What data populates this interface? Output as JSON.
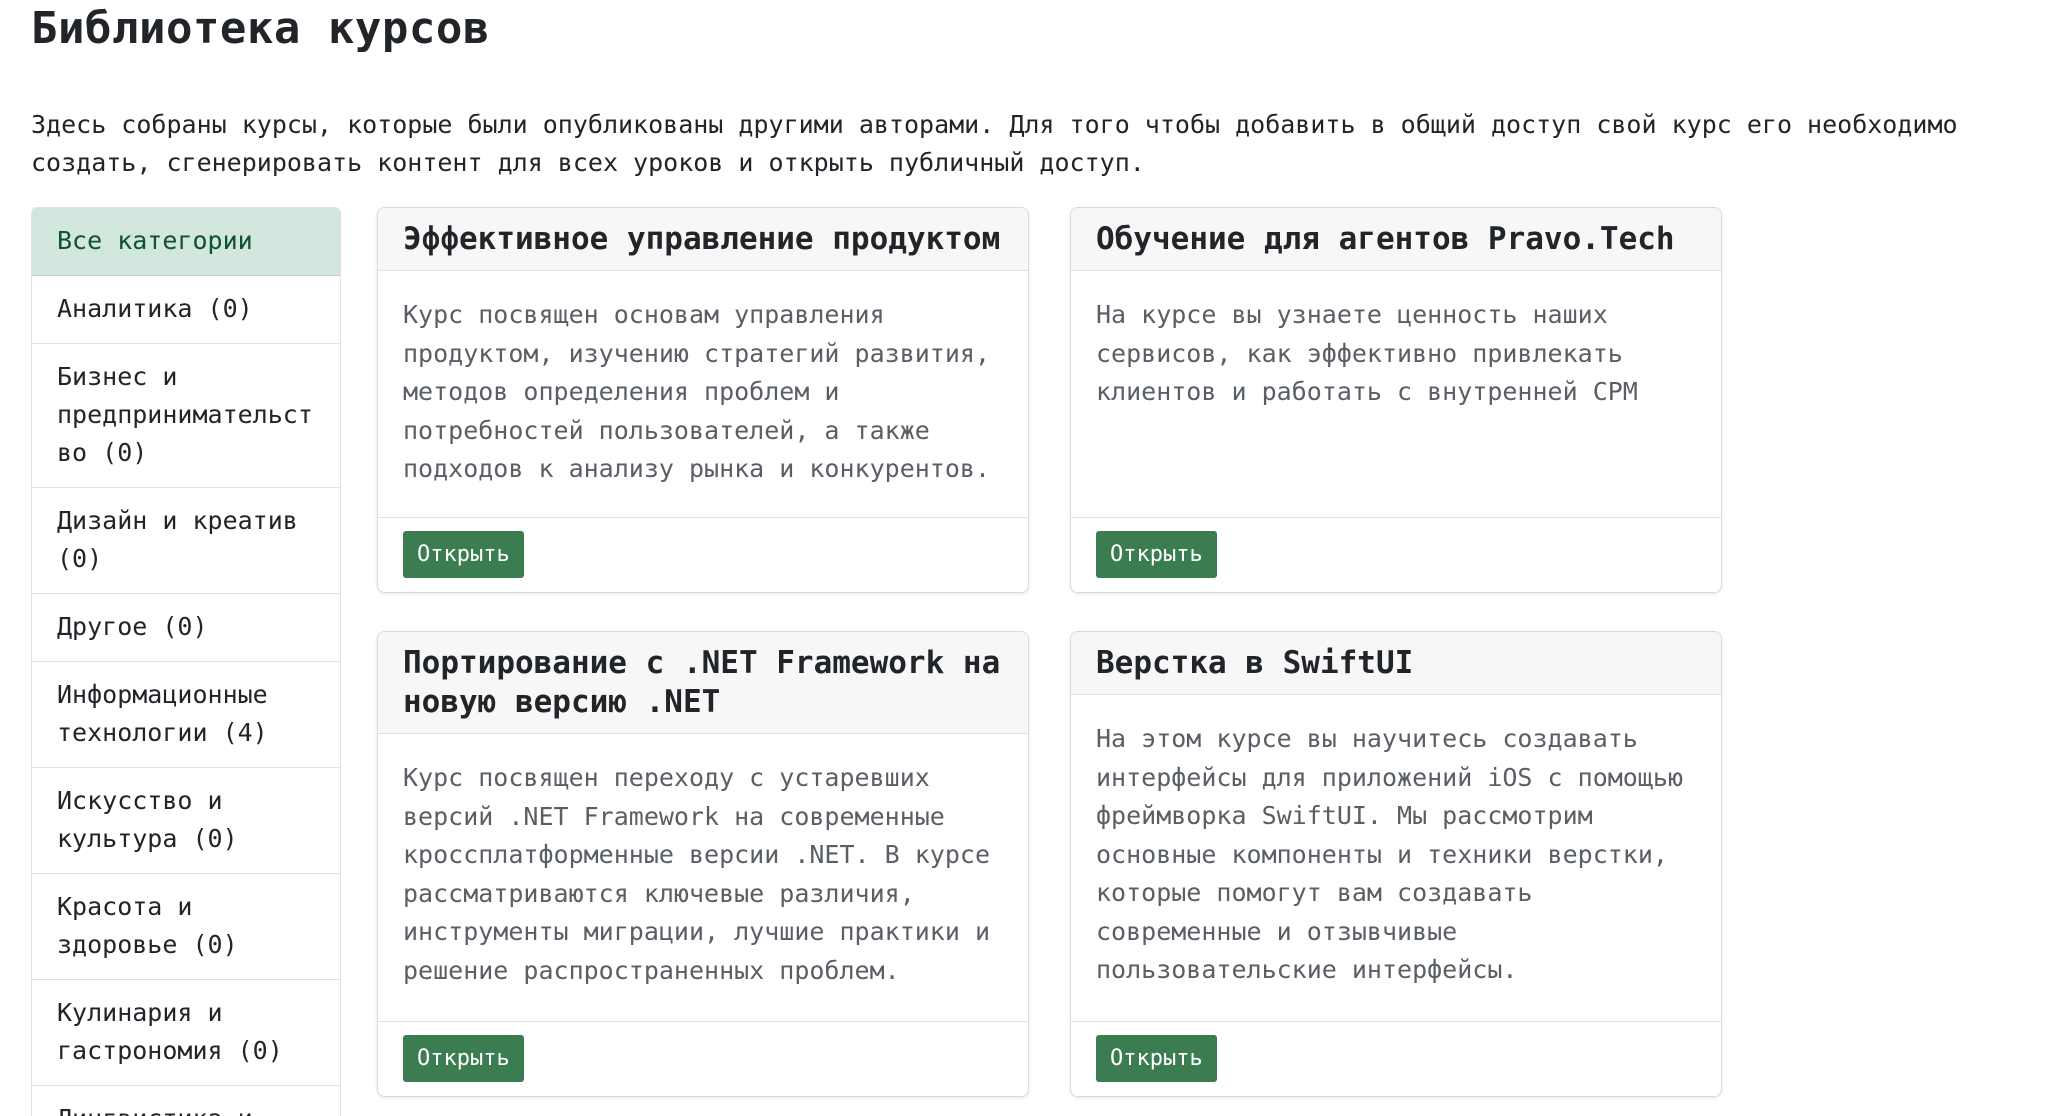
{
  "page": {
    "title": "Библиотека курсов",
    "intro": "Здесь собраны курсы, которые были опубликованы другими авторами. Для того чтобы добавить в общий доступ свой курс его необходимо создать, сгенерировать контент для всех уроков и открыть публичный доступ."
  },
  "sidebar": {
    "items": [
      {
        "label": "Все категории"
      },
      {
        "label": "Аналитика (0)"
      },
      {
        "label": "Бизнес и предпринимательство (0)"
      },
      {
        "label": "Дизайн и креатив (0)"
      },
      {
        "label": "Другое (0)"
      },
      {
        "label": "Информационные технологии (4)"
      },
      {
        "label": "Искусство и культура (0)"
      },
      {
        "label": "Красота и здоровье (0)"
      },
      {
        "label": "Кулинария и гастрономия (0)"
      },
      {
        "label": "Лингвистика и"
      }
    ],
    "active_index": 0
  },
  "cards": [
    {
      "title": "Эффективное управление продуктом",
      "description": "Курс посвящен основам управления продуктом, изучению стратегий развития, методов определения проблем и потребностей пользователей, а также подходов к анализу рынка и конкурентов.",
      "button_label": "Открыть"
    },
    {
      "title": "Обучение для агентов Pravo.Tech",
      "description": "На курсе вы узнаете ценность наших сервисов, как эффективно привлекать клиентов и работать с внутренней CPM",
      "button_label": "Открыть"
    },
    {
      "title": "Портирование с .NET Framework на новую версию .NET",
      "description": "Курс посвящен переходу с устаревших версий .NET Framework на современные кроссплатформенные версии .NET. В курсе рассматриваются ключевые различия, инструменты миграции, лучшие практики и решение распространенных проблем.",
      "button_label": "Открыть"
    },
    {
      "title": "Верстка в SwiftUI",
      "description": "На этом курсе вы научитесь создавать интерфейсы для приложений iOS с помощью фреймворка SwiftUI. Мы рассмотрим основные компоненты и техники верстки, которые помогут вам создавать современные и отзывчивые пользовательские интерфейсы.",
      "button_label": "Открыть"
    }
  ],
  "colors": {
    "accent_button": "#3b7d50",
    "active_category_bg": "#d1e7dd"
  }
}
